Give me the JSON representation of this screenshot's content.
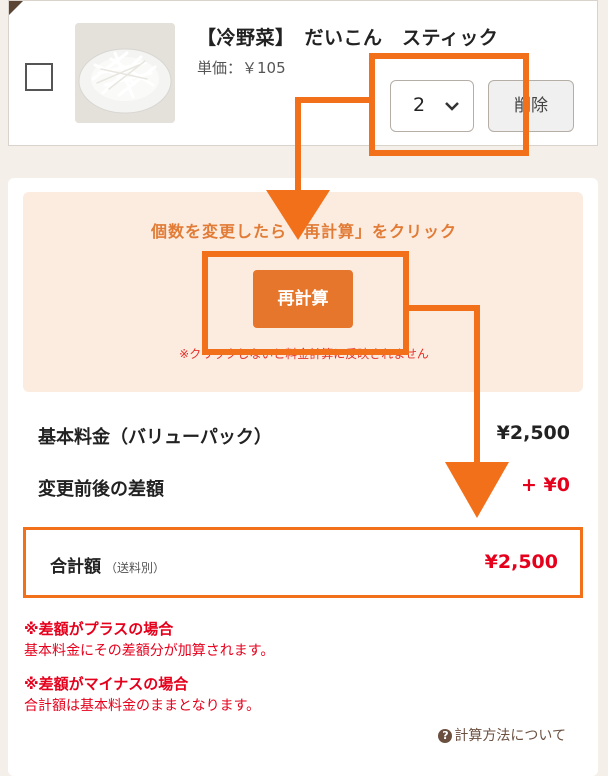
{
  "cart_item": {
    "name": "【冷野菜】　だいこん　スティック",
    "price": "単価：￥105",
    "quantity": "2",
    "delete_label": "削除",
    "image_icon": "daikon-sticks-photo"
  },
  "recalc": {
    "notice": "個数を変更したら「再計算」をクリック",
    "button_label": "再計算",
    "warning": "※クリックしないと料金計算に反映されません"
  },
  "summary": {
    "basic_label": "基本料金（バリューパック）",
    "basic_value": "¥2,500",
    "diff_label": "変更前後の差額",
    "diff_value": "+ ¥0",
    "total_label": "合計額",
    "total_note": "（送料別）",
    "total_value": "¥2,500"
  },
  "notes": {
    "plus_head": "※差額がプラスの場合",
    "plus_body": "基本料金にその差額分が加算されます。",
    "minus_head": "※差額がマイナスの場合",
    "minus_body": "合計額は基本料金のままとなります。"
  },
  "help": {
    "icon": "question-circle-icon",
    "label": "計算方法について"
  },
  "colors": {
    "accent_orange": "#f27019",
    "button_orange": "#e5762b",
    "notice_bg": "#fcebdf",
    "red_text": "#e5001c"
  }
}
